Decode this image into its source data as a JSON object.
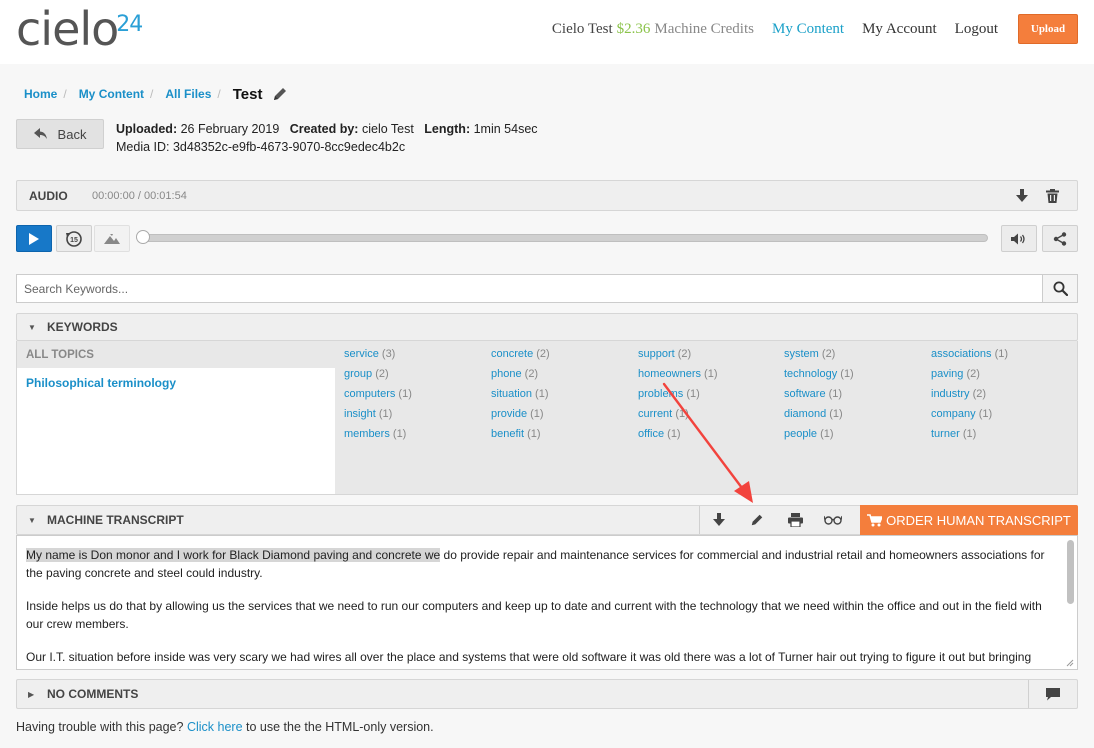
{
  "header": {
    "logo_text": "cielo",
    "logo_sup": "24",
    "user_name": "Cielo Test",
    "credits": "$2.36",
    "credits_label": "Machine Credits",
    "nav": {
      "my_content": "My Content",
      "my_account": "My Account",
      "logout": "Logout"
    },
    "upload_label": "Upload",
    "colors": {
      "accent": "#1aa0c8",
      "upload": "#f47e3c",
      "credits": "#8bc34a"
    }
  },
  "breadcrumb": {
    "items": [
      "Home",
      "My Content",
      "All Files"
    ],
    "separator": "/",
    "current": "Test",
    "edit_icon": "pencil-icon"
  },
  "back_label": "Back",
  "meta": {
    "uploaded_label": "Uploaded:",
    "uploaded_value": "26 February 2019",
    "created_label": "Created by:",
    "created_value": "cielo Test",
    "length_label": "Length:",
    "length_value": "1min 54sec",
    "media_id": "Media ID: 3d48352c-e9fb-4673-9070-8cc9edec4b2c"
  },
  "audio": {
    "title": "AUDIO",
    "time": "00:00:00 / 00:01:54",
    "progress": 0.0,
    "icons": [
      "download-icon",
      "trash-icon",
      "play-icon",
      "rewind-15-icon",
      "speed-icon",
      "volume-icon",
      "share-icon"
    ],
    "replay_label": "15"
  },
  "search": {
    "placeholder": "Search Keywords..."
  },
  "keywords": {
    "title": "KEYWORDS",
    "topics_header": "ALL TOPICS",
    "topics": [
      "Philosophical terminology"
    ],
    "columns": [
      [
        {
          "word": "service",
          "count": "(3)"
        },
        {
          "word": "group",
          "count": "(2)"
        },
        {
          "word": "computers",
          "count": "(1)"
        },
        {
          "word": "insight",
          "count": "(1)"
        },
        {
          "word": "members",
          "count": "(1)"
        }
      ],
      [
        {
          "word": "concrete",
          "count": "(2)"
        },
        {
          "word": "phone",
          "count": "(2)"
        },
        {
          "word": "situation",
          "count": "(1)"
        },
        {
          "word": "provide",
          "count": "(1)"
        },
        {
          "word": "benefit",
          "count": "(1)"
        }
      ],
      [
        {
          "word": "support",
          "count": "(2)"
        },
        {
          "word": "homeowners",
          "count": "(1)"
        },
        {
          "word": "problems",
          "count": "(1)"
        },
        {
          "word": "current",
          "count": "(1)"
        },
        {
          "word": "office",
          "count": "(1)"
        }
      ],
      [
        {
          "word": "system",
          "count": "(2)"
        },
        {
          "word": "technology",
          "count": "(1)"
        },
        {
          "word": "software",
          "count": "(1)"
        },
        {
          "word": "diamond",
          "count": "(1)"
        },
        {
          "word": "people",
          "count": "(1)"
        }
      ],
      [
        {
          "word": "associations",
          "count": "(1)"
        },
        {
          "word": "paving",
          "count": "(2)"
        },
        {
          "word": "industry",
          "count": "(2)"
        },
        {
          "word": "company",
          "count": "(1)"
        },
        {
          "word": "turner",
          "count": "(1)"
        }
      ]
    ]
  },
  "transcript": {
    "title": "MACHINE TRANSCRIPT",
    "icons": [
      "download-icon",
      "pencil-icon",
      "print-icon",
      "glasses-icon"
    ],
    "order_label": "ORDER HUMAN TRANSCRIPT",
    "highlight": "My name is Don monor and I work for Black Diamond paving and concrete we",
    "p1_rest": " do provide repair and maintenance services for commercial and industrial retail and homeowners associations for the paving concrete and steel could industry.",
    "p2": "Inside helps us do that by allowing us the services that we need to run our computers and keep up to date and current with the technology that we need within the office and out in the field with our crew members.",
    "p3": "Our I.T. situation before inside was very scary we had wires all over the place and systems that were old software it was old there was a lot of Turner hair out trying to figure it out but bringing insight"
  },
  "comments": {
    "title": "NO COMMENTS",
    "icon": "comment-icon"
  },
  "footer": {
    "prefix": "Having trouble with this page?",
    "link": "Click here",
    "suffix": "to use the the HTML-only version."
  }
}
